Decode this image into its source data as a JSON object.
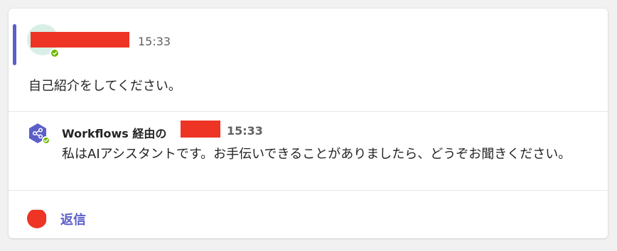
{
  "message": {
    "time": "15:33",
    "body": "自己紹介をしてください。"
  },
  "reply": {
    "via_label": "Workflows 経由の",
    "time": "15:33",
    "body": "私はAIアシスタントです。お手伝いできることがありましたら、どうぞお聞きください。"
  },
  "footer": {
    "reply_label": "返信"
  },
  "colors": {
    "accent": "#5b5fc7",
    "status_available": "#6bb700",
    "redaction": "#ee3424"
  }
}
